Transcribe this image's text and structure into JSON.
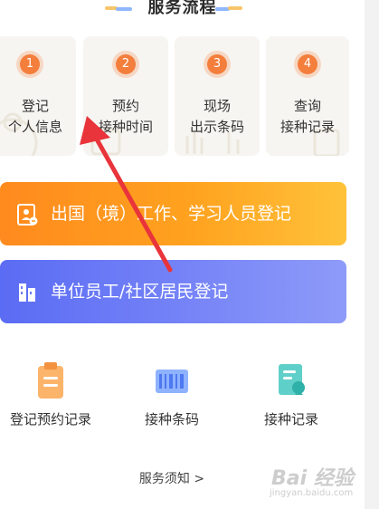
{
  "section_title": "服务流程",
  "steps": [
    {
      "num": "1",
      "line1": "登记",
      "line2": "个人信息"
    },
    {
      "num": "2",
      "line1": "预约",
      "line2": "接种时间"
    },
    {
      "num": "3",
      "line1": "现场",
      "line2": "出示条码"
    },
    {
      "num": "4",
      "line1": "查询",
      "line2": "接种记录"
    }
  ],
  "banners": {
    "abroad": "出国（境）工作、学习人员登记",
    "unit": "单位员工/社区居民登记"
  },
  "quick_actions": [
    {
      "label": "登记预约记录",
      "icon": "clipboard-icon"
    },
    {
      "label": "接种条码",
      "icon": "barcode-icon"
    },
    {
      "label": "接种记录",
      "icon": "record-document-icon"
    }
  ],
  "footer_link": "服务须知 >",
  "watermark": {
    "text": "Bai 经验",
    "sub": "jingyan.baidu.com"
  },
  "colors": {
    "orange": "#f47e3c",
    "banner_orange": "#ffa21f",
    "banner_blue": "#6f7cf6",
    "arrow": "#e8343a"
  }
}
